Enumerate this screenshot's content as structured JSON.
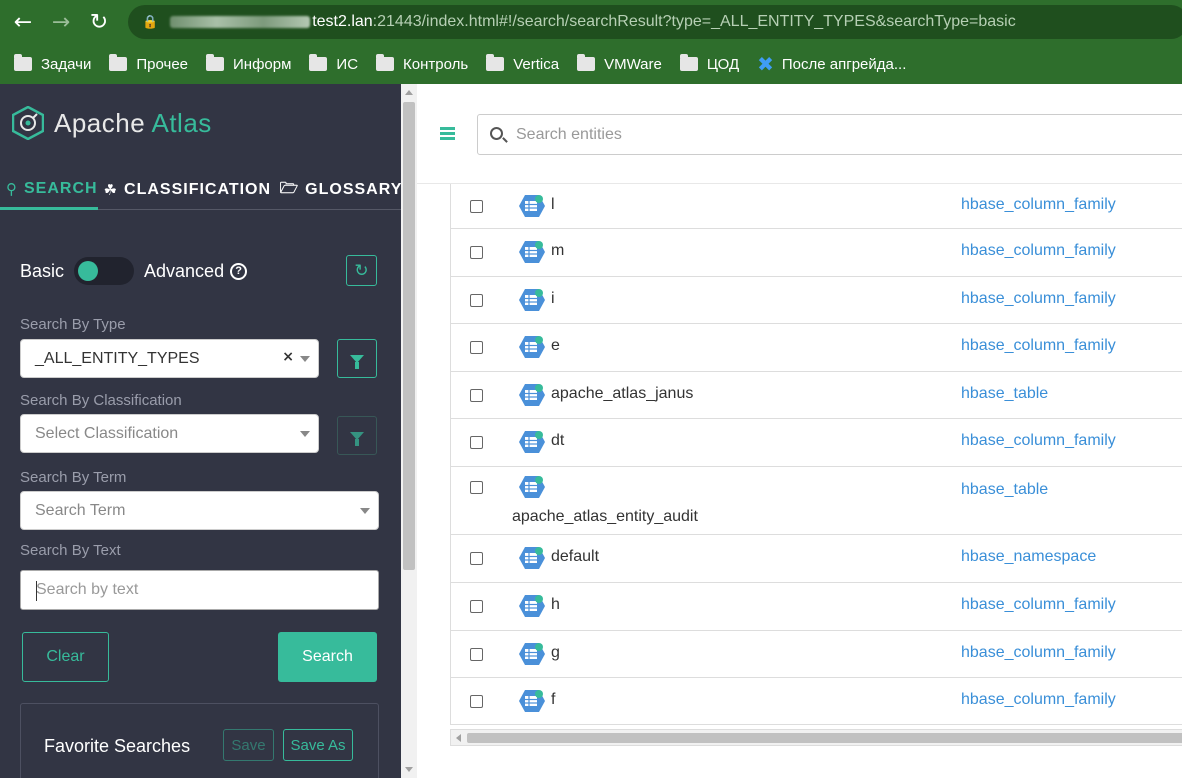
{
  "browser": {
    "url_host": "test2.lan",
    "url_rest": ":21443/index.html#!/search/searchResult?type=_ALL_ENTITY_TYPES&searchType=basic",
    "bookmarks": [
      "Задачи",
      "Прочее",
      "Информ",
      "ИС",
      "Контроль",
      "Vertica",
      "VMWare",
      "ЦОД"
    ],
    "bookmark_special": "После апгрейда..."
  },
  "sidebar": {
    "logo_apache": "Apache",
    "logo_atlas": "Atlas",
    "tabs": [
      "SEARCH",
      "CLASSIFICATION",
      "GLOSSARY"
    ],
    "toggle_basic": "Basic",
    "toggle_advanced": "Advanced",
    "type_label": "Search By Type",
    "type_value": "_ALL_ENTITY_TYPES",
    "classification_label": "Search By Classification",
    "classification_placeholder": "Select Classification",
    "term_label": "Search By Term",
    "term_placeholder": "Search Term",
    "text_label": "Search By Text",
    "text_placeholder": "Search by text",
    "clear_label": "Clear",
    "search_label": "Search",
    "favorites_title": "Favorite Searches",
    "save_label": "Save",
    "save_as_label": "Save As"
  },
  "main": {
    "search_placeholder": "Search entities",
    "rows": [
      {
        "name": "l",
        "type": "hbase_column_family"
      },
      {
        "name": "m",
        "type": "hbase_column_family"
      },
      {
        "name": "i",
        "type": "hbase_column_family"
      },
      {
        "name": "e",
        "type": "hbase_column_family"
      },
      {
        "name": "apache_atlas_janus",
        "type": "hbase_table"
      },
      {
        "name": "dt",
        "type": "hbase_column_family"
      },
      {
        "name": "apache_atlas_entity_audit",
        "type": "hbase_table"
      },
      {
        "name": "default",
        "type": "hbase_namespace"
      },
      {
        "name": "h",
        "type": "hbase_column_family"
      },
      {
        "name": "g",
        "type": "hbase_column_family"
      },
      {
        "name": "f",
        "type": "hbase_column_family"
      }
    ]
  },
  "colors": {
    "accent": "#37bb9b",
    "sidebar_bg": "#323544",
    "browser_bg": "#2e6e2c",
    "link": "#3a8fd8"
  }
}
